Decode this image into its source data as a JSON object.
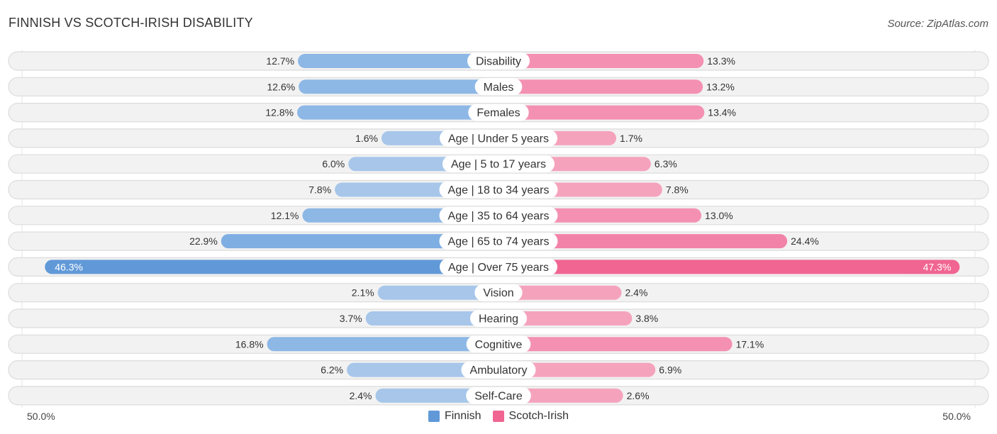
{
  "header": {
    "title": "FINNISH VS SCOTCH-IRISH DISABILITY",
    "source": "Source: ZipAtlas.com"
  },
  "colors": {
    "finnish": "#6199d8",
    "finnish_light": "#a7c6ea",
    "scotch_irish": "#f06592",
    "scotch_irish_light": "#f5a3bd",
    "row_bg": "#f2f2f2",
    "row_border": "#dcdcdc"
  },
  "axis": {
    "left_label": "50.0%",
    "right_label": "50.0%"
  },
  "legend": [
    {
      "name": "Finnish",
      "color": "#6199d8"
    },
    {
      "name": "Scotch-Irish",
      "color": "#f06592"
    }
  ],
  "chart_data": {
    "type": "bar",
    "orientation": "horizontal-diverging",
    "title": "FINNISH VS SCOTCH-IRISH DISABILITY",
    "xlabel": "",
    "ylabel": "",
    "xlim": [
      -50,
      50
    ],
    "legend_position": "bottom-center",
    "categories": [
      "Disability",
      "Males",
      "Females",
      "Age | Under 5 years",
      "Age | 5 to 17 years",
      "Age | 18 to 34 years",
      "Age | 35 to 64 years",
      "Age | 65 to 74 years",
      "Age | Over 75 years",
      "Vision",
      "Hearing",
      "Cognitive",
      "Ambulatory",
      "Self-Care"
    ],
    "series": [
      {
        "name": "Finnish",
        "side": "left",
        "values": [
          12.7,
          12.6,
          12.8,
          1.6,
          6.0,
          7.8,
          12.1,
          22.9,
          46.3,
          2.1,
          3.7,
          16.8,
          6.2,
          2.4
        ],
        "labels": [
          "12.7%",
          "12.6%",
          "12.8%",
          "1.6%",
          "6.0%",
          "7.8%",
          "12.1%",
          "22.9%",
          "46.3%",
          "2.1%",
          "3.7%",
          "16.8%",
          "6.2%",
          "2.4%"
        ]
      },
      {
        "name": "Scotch-Irish",
        "side": "right",
        "values": [
          13.3,
          13.2,
          13.4,
          1.7,
          6.3,
          7.8,
          13.0,
          24.4,
          47.3,
          2.4,
          3.8,
          17.1,
          6.9,
          2.6
        ],
        "labels": [
          "13.3%",
          "13.2%",
          "13.4%",
          "1.7%",
          "6.3%",
          "7.8%",
          "13.0%",
          "24.4%",
          "47.3%",
          "2.4%",
          "3.8%",
          "17.1%",
          "6.9%",
          "2.6%"
        ]
      }
    ]
  }
}
